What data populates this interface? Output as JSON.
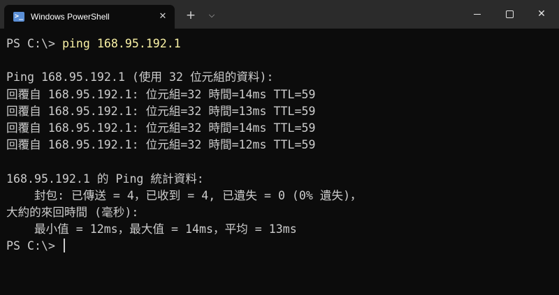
{
  "window": {
    "tab_title": "Windows PowerShell",
    "tab_icon": "powershell-icon",
    "close_tab_glyph": "✕",
    "new_tab_glyph": "+",
    "dropdown_glyph": "⌵",
    "minimize_icon": "minimize-icon",
    "maximize_icon": "maximize-icon",
    "close_glyph": "✕"
  },
  "terminal": {
    "prompt": "PS C:\\> ",
    "command": "ping 168.95.192.1",
    "lines": [
      "",
      "Ping 168.95.192.1 (使用 32 位元組的資料):",
      "回覆自 168.95.192.1: 位元組=32 時間=14ms TTL=59",
      "回覆自 168.95.192.1: 位元組=32 時間=13ms TTL=59",
      "回覆自 168.95.192.1: 位元組=32 時間=14ms TTL=59",
      "回覆自 168.95.192.1: 位元組=32 時間=12ms TTL=59",
      "",
      "168.95.192.1 的 Ping 統計資料:",
      "    封包: 已傳送 = 4，已收到 = 4, 已遺失 = 0 (0% 遺失)，",
      "大約的來回時間 (毫秒):",
      "    最小值 = 12ms，最大值 = 14ms，平均 = 13ms"
    ],
    "final_prompt": "PS C:\\> "
  },
  "colors": {
    "background": "#0c0c0c",
    "titlebar": "#2b2b2b",
    "text": "#cccccc",
    "command": "#f9f1a5"
  }
}
